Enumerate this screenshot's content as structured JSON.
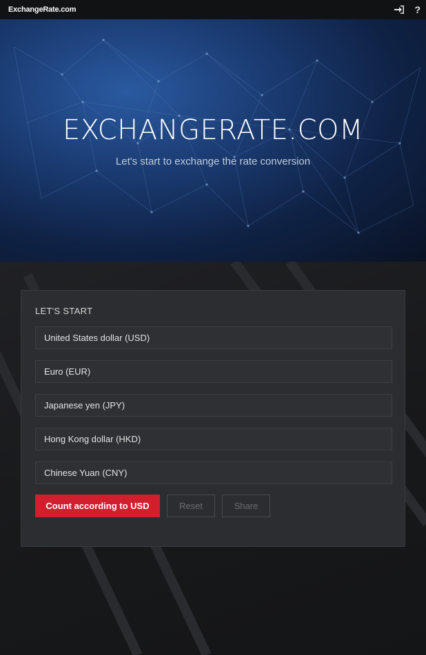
{
  "topbar": {
    "brand": "ExchangeRate.com",
    "icons": [
      "sign-in-icon",
      "help-icon"
    ],
    "help_glyph": "?"
  },
  "hero": {
    "title": "EXCHANGERATE.COM",
    "subtitle": "Let's start to exchange the rate conversion"
  },
  "card": {
    "title": "LET'S START",
    "fields": [
      "United States dollar (USD)",
      "Euro (EUR)",
      "Japanese yen (JPY)",
      "Hong Kong dollar (HKD)",
      "Chinese Yuan (CNY)"
    ],
    "buttons": {
      "count": "Count according to USD",
      "reset": "Reset",
      "share": "Share"
    }
  },
  "colors": {
    "accent": "#d11f2e",
    "topbar": "#111214",
    "card": "#2c2d30"
  }
}
